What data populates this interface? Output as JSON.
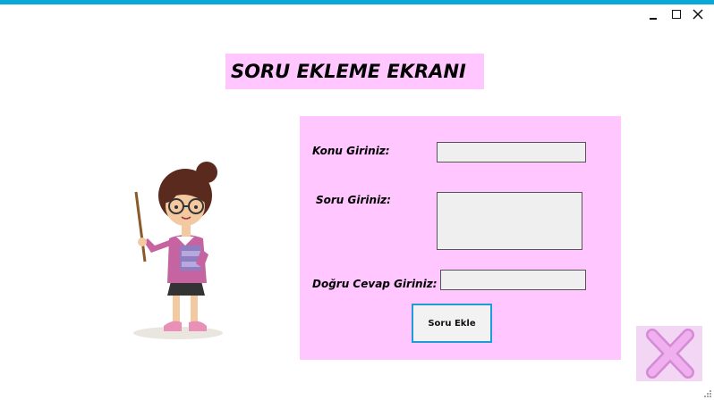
{
  "window": {
    "title_bar_color": "#0aa7d9"
  },
  "header": {
    "title": "SORU EKLEME EKRANI"
  },
  "form": {
    "topic_label": "Konu Giriniz:",
    "topic_value": "",
    "question_label": "Soru Giriniz:",
    "question_value": "",
    "answer_label": "Doğru Cevap Giriniz:",
    "answer_value": "",
    "submit_label": "Soru Ekle"
  },
  "colors": {
    "panel": "#ffc6ff",
    "accent_border": "#1e9bd8",
    "close_x": "#f0a0f0"
  },
  "icons": {
    "close_window": "close-icon",
    "exit": "pink-x-icon",
    "illustration": "teacher-illustration"
  }
}
